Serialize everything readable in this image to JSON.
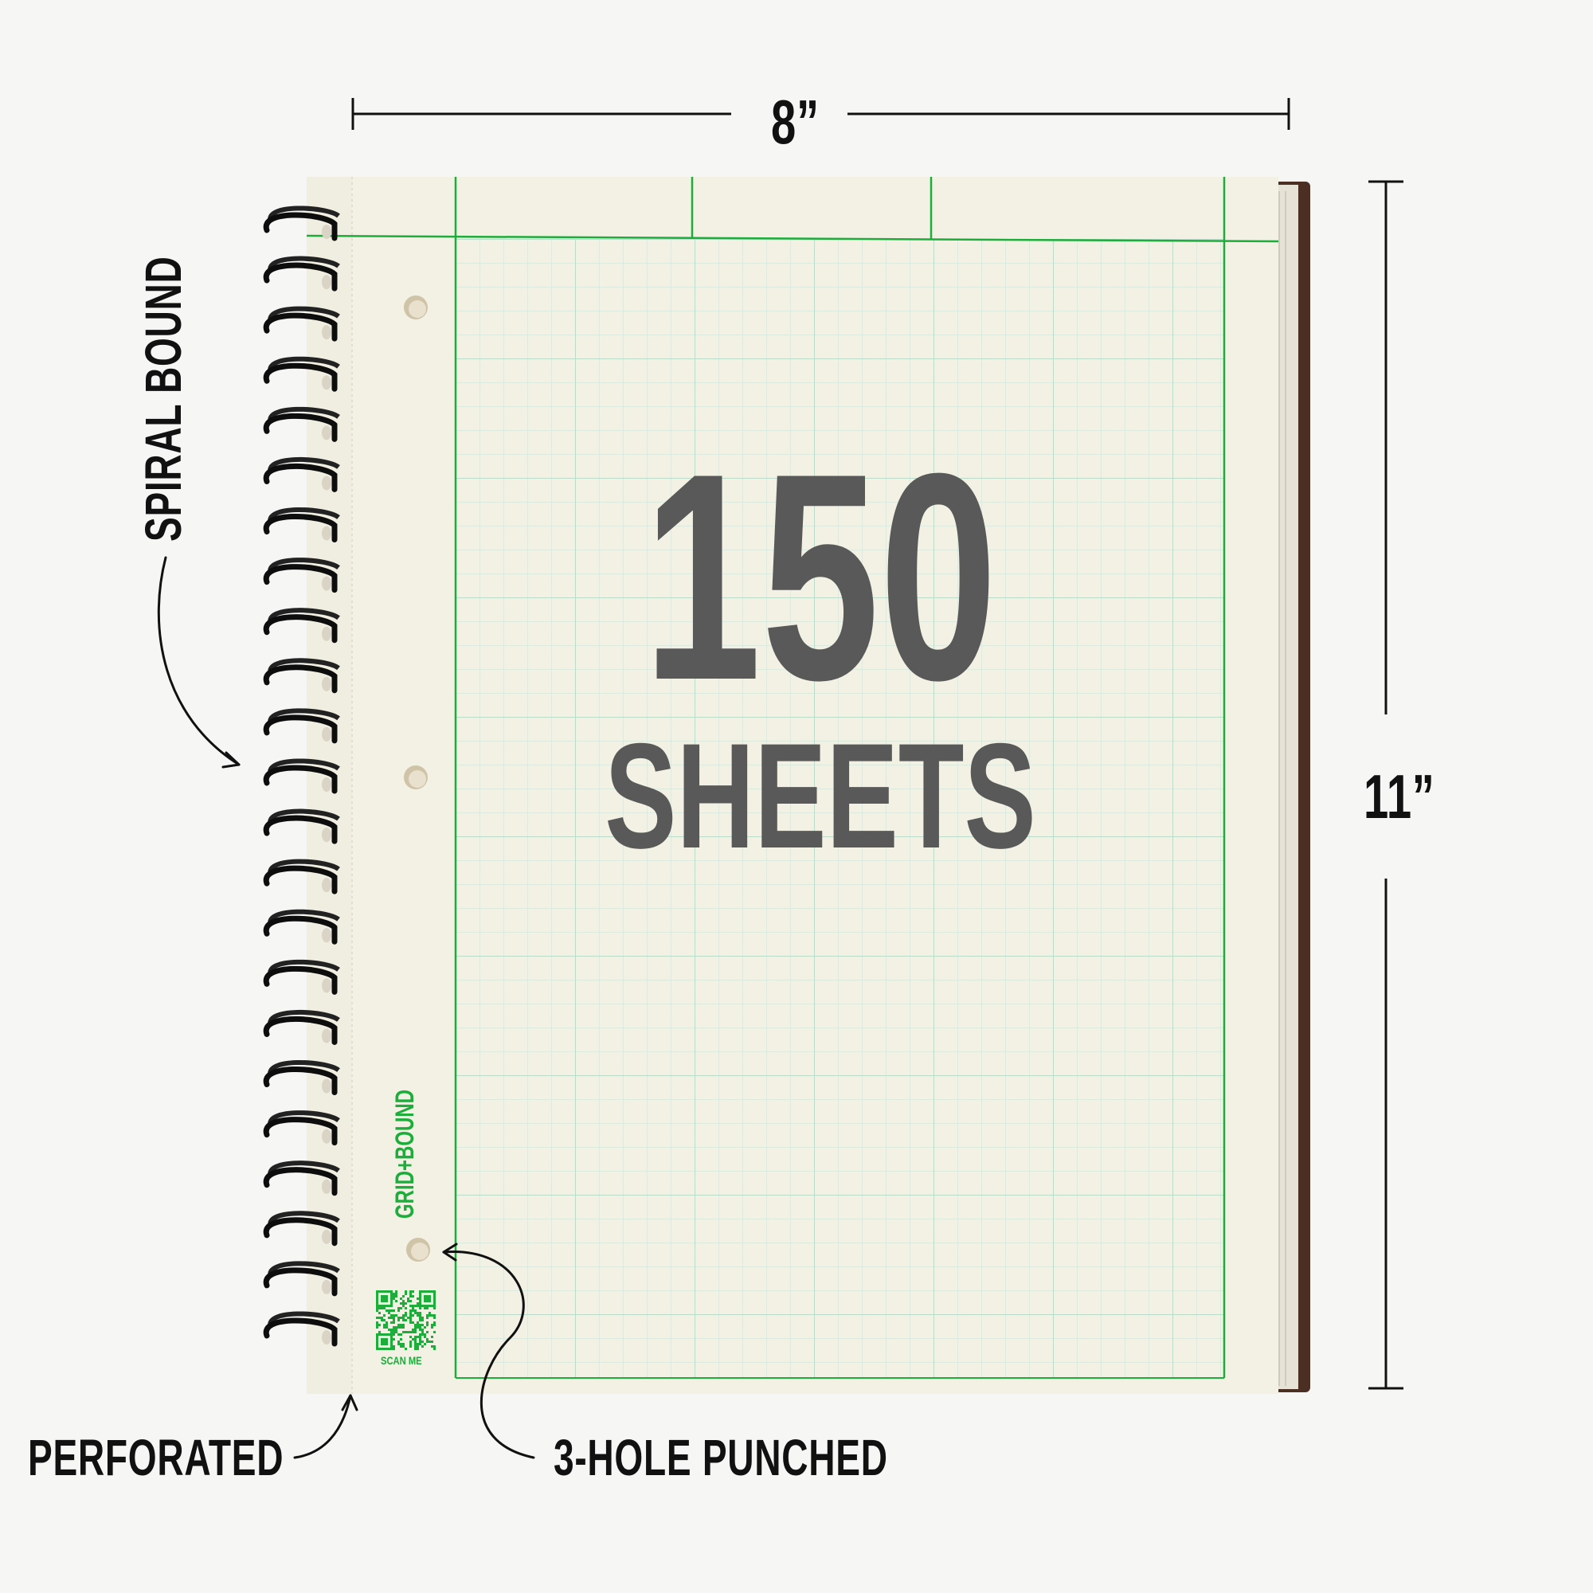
{
  "dimensions": {
    "width": "8”",
    "height": "11”"
  },
  "callouts": {
    "spiral": "SPIRAL BOUND",
    "perforated": "PERFORATED",
    "holes": "3-HOLE PUNCHED"
  },
  "cover": {
    "count": "150",
    "unit": "SHEETS",
    "brand": "GRID+BOUND",
    "qr_label": "SCAN ME"
  },
  "colors": {
    "paper": "#f3f0e4",
    "grid_line": "#c6e2d4",
    "accent_green": "#1cad3a",
    "big_text": "#595959",
    "cover_edge": "#4a2f22"
  }
}
